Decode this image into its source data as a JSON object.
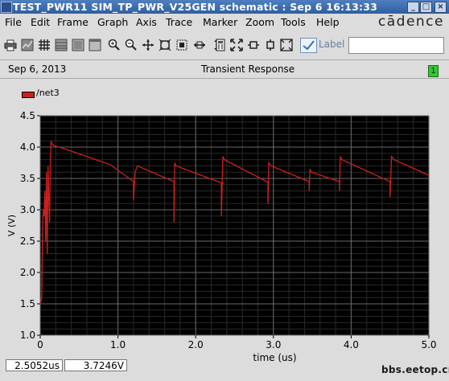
{
  "window": {
    "title": "TEST_PWR11 SIM_TP_PWR_V25GEN schematic : Sep  6 16:13:33",
    "buttons": [
      "_",
      "□",
      "×"
    ]
  },
  "menu": {
    "items": [
      "File",
      "Edit",
      "Frame",
      "Graph",
      "Axis",
      "Trace",
      "Marker",
      "Zoom",
      "Tools",
      "Help"
    ],
    "brand": "cādence"
  },
  "toolbar": {
    "icons": [
      "printer-icon",
      "graph-icon",
      "grid-icon",
      "strip-icon",
      "frame-icon",
      "frame2-icon",
      "zoom-in-icon",
      "zoom-out-icon",
      "pan-icon",
      "fit-icon",
      "clip-icon",
      "horizontal-zoom-icon",
      "vertical-zoom-icon",
      "calculator-icon",
      "zoom-fit-icon",
      "zoom-x-icon",
      "zoom-y-icon",
      "zoom-box-icon"
    ],
    "label_text": "Label",
    "label_value": ""
  },
  "info": {
    "date": "Sep 6, 2013",
    "title": "Transient Response",
    "subwindow": "1"
  },
  "readout": {
    "x": "2.5052us",
    "y": "3.7246V"
  },
  "watermark": "bbs.eetop.cn",
  "chart_data": {
    "type": "line",
    "series": [
      {
        "name": "/net3",
        "color": "#cc2020",
        "x": [
          0.0,
          0.02,
          0.03,
          0.04,
          0.05,
          0.06,
          0.07,
          0.08,
          0.09,
          0.1,
          0.11,
          0.12,
          0.13,
          0.14,
          0.15,
          0.18,
          0.3,
          0.6,
          0.9,
          1.2,
          1.2,
          1.22,
          1.25,
          1.72,
          1.72,
          1.73,
          1.75,
          2.33,
          2.33,
          2.35,
          2.37,
          2.93,
          2.93,
          2.94,
          2.97,
          3.46,
          3.46,
          3.47,
          3.49,
          3.85,
          3.85,
          3.86,
          3.88,
          4.5,
          4.5,
          4.52,
          4.55,
          5.0
        ],
        "y": [
          1.5,
          1.6,
          2.7,
          3.0,
          2.9,
          3.3,
          2.5,
          3.6,
          2.3,
          3.7,
          3.2,
          2.8,
          3.8,
          4.1,
          4.05,
          4.02,
          3.98,
          3.85,
          3.72,
          3.45,
          3.15,
          3.6,
          3.7,
          3.45,
          2.8,
          3.75,
          3.7,
          3.43,
          2.9,
          3.85,
          3.8,
          3.44,
          3.1,
          3.75,
          3.7,
          3.45,
          3.3,
          3.65,
          3.6,
          3.45,
          3.3,
          3.85,
          3.8,
          3.45,
          3.2,
          3.85,
          3.8,
          3.55
        ]
      }
    ],
    "xlabel": "time (us)",
    "ylabel": "V (V)",
    "xlim": [
      0,
      5.0
    ],
    "ylim": [
      1.0,
      4.5
    ],
    "xticks": [
      0,
      1.0,
      2.0,
      3.0,
      4.0,
      5.0
    ],
    "yticks": [
      1.0,
      1.5,
      2.0,
      2.5,
      3.0,
      3.5,
      4.0,
      4.5
    ],
    "xtick_labels": [
      "0",
      "1.0",
      "2.0",
      "3.0",
      "4.0",
      "5.0"
    ],
    "ytick_labels": [
      "1.0",
      "1.5",
      "2.0",
      "2.5",
      "3.0",
      "3.5",
      "4.0",
      "4.5"
    ],
    "grid": true,
    "background": "#000000",
    "grid_color": "#6a6a6a",
    "legend": "top-left"
  }
}
